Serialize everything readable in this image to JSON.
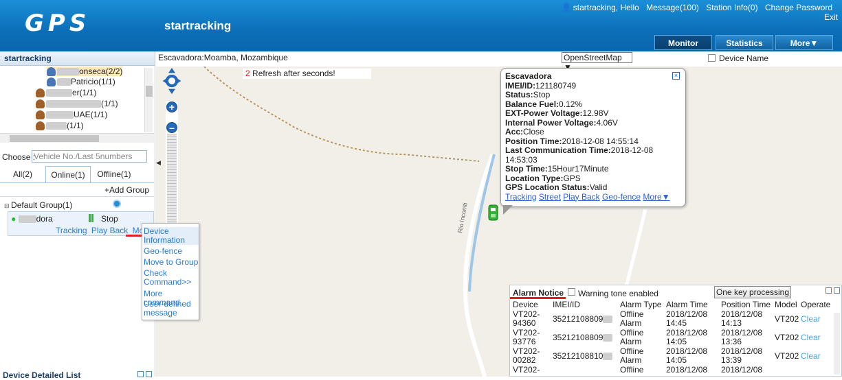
{
  "header": {
    "logo": "GPS",
    "app_title": "startracking",
    "user_greeting": "startracking, Hello",
    "message": "Message(100)",
    "station_info": "Station Info(0)",
    "change_password": "Change Password",
    "exit": "Exit",
    "tabs": [
      {
        "label": "Monitor",
        "active": true
      },
      {
        "label": "Statistics",
        "active": false
      },
      {
        "label": "More▼",
        "active": false
      }
    ]
  },
  "left_panel": {
    "title": "startracking",
    "tree": [
      {
        "label": "onseca(2/2)"
      },
      {
        "label": "Patricio(1/1)"
      },
      {
        "label": "er(1/1)"
      },
      {
        "label": "(1/1)"
      },
      {
        "label": "UAE(1/1)"
      },
      {
        "label": "(1/1)"
      }
    ],
    "choose_label": "Choose :",
    "choose_placeholder": "Vehicle No./Last 5numbers",
    "filter_tabs": {
      "all": "All(2)",
      "online": "Online(1)",
      "offline": "Offline(1)"
    },
    "add_group": "+Add Group",
    "default_group": "Default Group(1)",
    "device": {
      "name": "dora",
      "status": "Stop",
      "links": [
        "Tracking",
        "Play Back",
        "More"
      ]
    },
    "bottom_label": "Device Detailed List"
  },
  "popup_menu": [
    "Device Information",
    "Geo-fence",
    "Move to Group",
    "Check Command>>",
    "More command",
    "User-defined message"
  ],
  "map": {
    "location_label": "Escavadora:Moamba, Mozambique",
    "map_source": "OpenStreetMap",
    "device_name_label": "Device Name",
    "refresh_count": "2",
    "refresh_text": " Refresh after seconds!",
    "road_label": "Rio Inconiti",
    "info": {
      "title": "Escavadora",
      "rows": [
        {
          "k": "IMEI/ID:",
          "v": "121180749"
        },
        {
          "k": "Status:",
          "v": "Stop"
        },
        {
          "k": "Balance Fuel:",
          "v": "0.12%"
        },
        {
          "k": "EXT-Power Voltage:",
          "v": "12.98V"
        },
        {
          "k": "Internal Power Voltage:",
          "v": "4.06V"
        },
        {
          "k": "Acc:",
          "v": "Close"
        },
        {
          "k": "Position Time:",
          "v": "2018-12-08 14:55:14"
        },
        {
          "k": "Last Communication Time:",
          "v": "2018-12-08 14:53:03"
        },
        {
          "k": "Stop Time:",
          "v": "15Hour17Minute"
        },
        {
          "k": "Location Type:",
          "v": "GPS"
        },
        {
          "k": "GPS Location Status:",
          "v": "Valid"
        }
      ],
      "links": [
        "Tracking",
        "Street",
        "Play Back",
        "Geo-fence",
        "More▼"
      ]
    }
  },
  "alarm": {
    "title": "Alarm Notice",
    "tone_label": "Warning tone enabled",
    "one_key": "One key processing",
    "columns": [
      "Device",
      "IMEI/ID",
      "Alarm Type",
      "Alarm Time",
      "Position Time",
      "Model",
      "Operate"
    ],
    "rows": [
      {
        "device": "VT202-94360",
        "imei": "35212108809",
        "type": "Offline Alarm",
        "alarm_time": "2018/12/08 14:45",
        "pos_time": "2018/12/08 14:13",
        "model": "VT202",
        "op": "Clear"
      },
      {
        "device": "VT202-93776",
        "imei": "35212108809",
        "type": "Offline Alarm",
        "alarm_time": "2018/12/08 14:05",
        "pos_time": "2018/12/08 13:36",
        "model": "VT202",
        "op": "Clear"
      },
      {
        "device": "VT202-00282",
        "imei": "35212108810",
        "type": "Offline Alarm",
        "alarm_time": "2018/12/08 14:05",
        "pos_time": "2018/12/08 13:39",
        "model": "VT202",
        "op": "Clear"
      },
      {
        "device": "VT202-",
        "imei": "",
        "type": "Offline",
        "alarm_time": "2018/12/08",
        "pos_time": "2018/12/08",
        "model": "",
        "op": ""
      }
    ]
  },
  "colors": {
    "header": "#0b6fb8",
    "link": "#2a7cd0",
    "alarm_red": "#e02020",
    "vehicle": "#2fb52f"
  }
}
